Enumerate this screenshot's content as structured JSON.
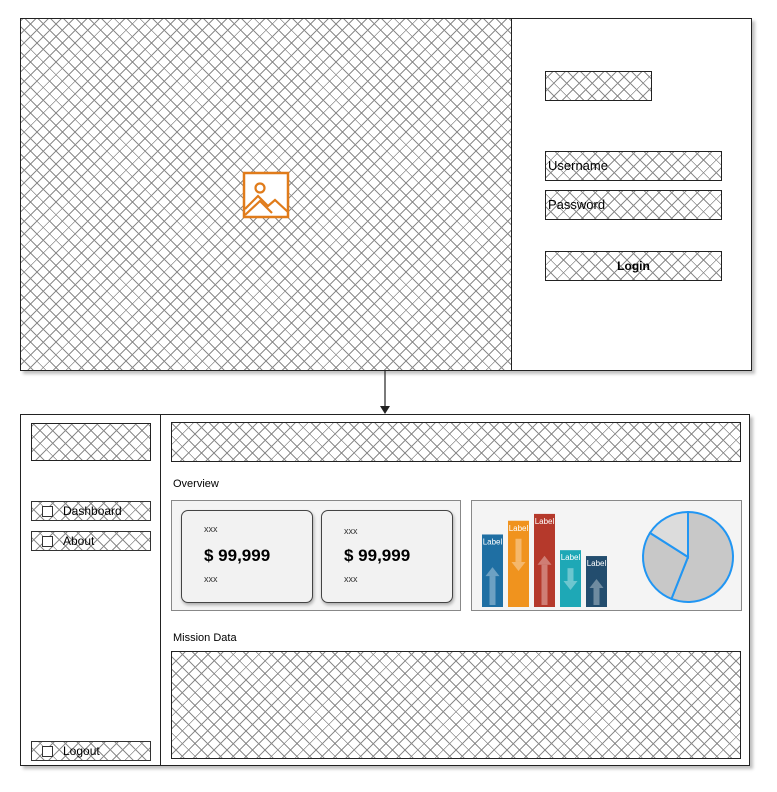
{
  "login": {
    "username_label": "Username",
    "password_label": "Password",
    "login_label": "Login",
    "image_icon": "image-icon"
  },
  "sidebar": {
    "items": [
      {
        "label": "Dashboard",
        "icon": "checkbox-icon"
      },
      {
        "label": "About",
        "icon": "checkbox-icon"
      }
    ],
    "logout_label": "Logout"
  },
  "main": {
    "overview_label": "Overview",
    "mission_label": "Mission Data",
    "cards": [
      {
        "top": "xxx",
        "value": "$ 99,999",
        "bottom": "xxx"
      },
      {
        "top": "xxx",
        "value": "$ 99,999",
        "bottom": "xxx"
      }
    ]
  },
  "chart_data": [
    {
      "type": "bar",
      "categories": [
        "",
        "",
        "",
        "",
        ""
      ],
      "bar_label": "Label",
      "values": [
        74,
        88,
        95,
        58,
        52
      ],
      "colors": [
        "#1f6fa3",
        "#f0931e",
        "#b5392b",
        "#1ea8b6",
        "#234d6e"
      ],
      "arrows": [
        "up",
        "down",
        "up",
        "down",
        "up"
      ]
    },
    {
      "type": "pie",
      "values": [
        56,
        28,
        16
      ],
      "colors": [
        "#c8c8c8",
        "#c8c8c8",
        "#dcdcdc"
      ],
      "stroke": "#2196f3"
    }
  ],
  "colors": {
    "accent_orange": "#e07b1a",
    "pie_stroke": "#2196f3"
  }
}
